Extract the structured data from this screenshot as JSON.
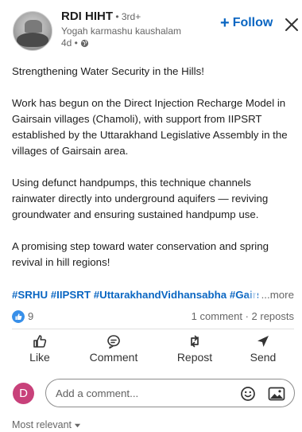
{
  "post": {
    "author_name": "RDI HIHT",
    "degree": " • 3rd+",
    "headline": "Yogah karmashu kaushalam",
    "time": "4d •",
    "follow_label": "Follow",
    "paragraphs": [
      "Strengthening Water Security in the Hills!",
      "Work has begun on the Direct Injection Recharge Model in Gairsain villages (Chamoli), with support from IIPSRT established by the Uttarakhand Legislative Assembly in the villages of Gairsain area.",
      "Using defunct handpumps, this technique channels rainwater directly into underground aquifers — reviving groundwater and ensuring sustained handpump use.",
      "A promising step toward water conservation and spring revival in hill regions!"
    ],
    "hashtags": "#SRHU #IIPSRT #UttarakhandVidhansabha #Gairsain",
    "more_label": "...more"
  },
  "social": {
    "reaction_count": "9",
    "counts_text": "1 comment · 2 reposts"
  },
  "actions": {
    "like": "Like",
    "comment": "Comment",
    "repost": "Repost",
    "send": "Send"
  },
  "comment": {
    "user_initial": "D",
    "placeholder": "Add a comment..."
  },
  "sort": {
    "label": "Most relevant"
  },
  "colors": {
    "accent": "#0a66c2",
    "like_badge": "#378fe9",
    "user_avatar": "#c8417a"
  }
}
